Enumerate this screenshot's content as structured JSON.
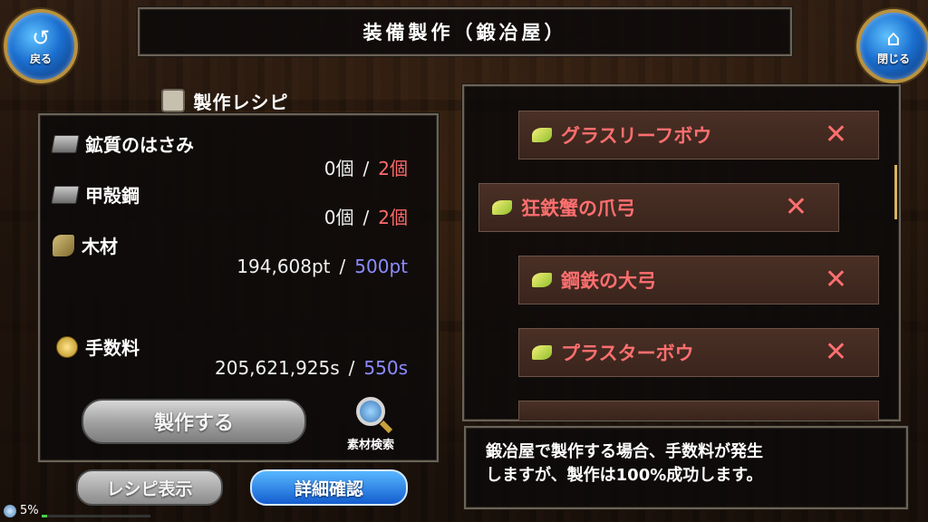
{
  "header": {
    "title": "装備製作（鍛冶屋）",
    "back_label": "戻る",
    "close_label": "閉じる"
  },
  "recipe": {
    "title": "製作レシピ",
    "materials": [
      {
        "name": "鉱質のはさみ",
        "have": "0個",
        "need": "2個",
        "icon": "ingot-icon"
      },
      {
        "name": "甲殻鋼",
        "have": "0個",
        "need": "2個",
        "icon": "ingot-icon"
      },
      {
        "name": "木材",
        "have": "194,608pt",
        "need": "500pt",
        "icon": "wood-icon"
      }
    ],
    "fee": {
      "name": "手数料",
      "have": "205,621,925s",
      "need": "550s",
      "icon": "coin-icon"
    },
    "slash": "/",
    "craft_button": "製作する",
    "search_label": "素材検索"
  },
  "bottom_buttons": {
    "recipe_view": "レシピ表示",
    "detail_check": "詳細確認"
  },
  "status": {
    "percent_text": "5%",
    "progress": 0.05
  },
  "item_list": [
    {
      "name": "グラスリーフボウ",
      "remove": "✕",
      "selected": false
    },
    {
      "name": "狂鉄蟹の爪弓",
      "remove": "✕",
      "selected": true
    },
    {
      "name": "鋼鉄の大弓",
      "remove": "✕",
      "selected": false
    },
    {
      "name": "プラスターボウ",
      "remove": "✕",
      "selected": false
    }
  ],
  "message": {
    "line1": "鍛冶屋で製作する場合、手数料が発生",
    "line2": "しますが、製作は100%成功します。"
  },
  "colors": {
    "need_red": "#ff6a6a",
    "need_blue": "#8c8cff",
    "accent_blue": "#135dd0"
  }
}
